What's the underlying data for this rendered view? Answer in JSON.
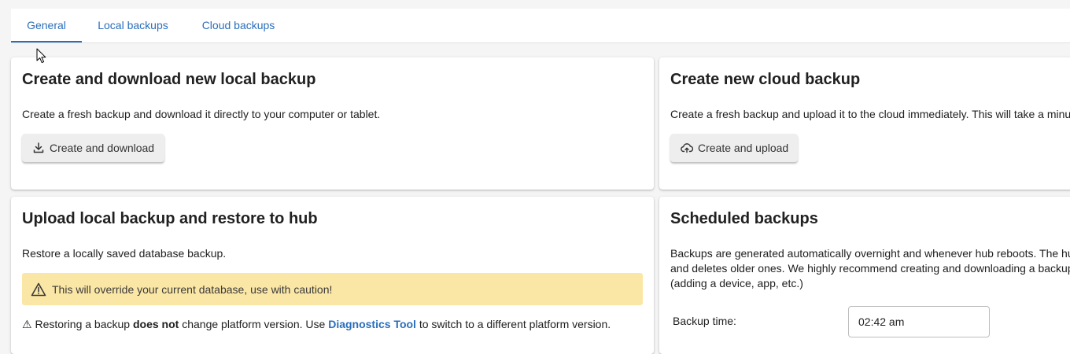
{
  "tabs": [
    {
      "label": "General",
      "active": true
    },
    {
      "label": "Local backups",
      "active": false
    },
    {
      "label": "Cloud backups",
      "active": false
    }
  ],
  "colors": {
    "accent": "#2a6ebb",
    "warning_bg": "#fbe7a5",
    "button_bg": "#eeeeee"
  },
  "local_backup": {
    "title": "Create and download new local backup",
    "description": "Create a fresh backup and download it directly to your computer or tablet.",
    "button_label": "Create and download",
    "button_icon": "download-icon"
  },
  "cloud_backup": {
    "title": "Create new cloud backup",
    "description": "Create a fresh backup and upload it to the cloud immediately. This will take a minu",
    "button_label": "Create and upload",
    "button_icon": "cloud-upload-icon"
  },
  "restore": {
    "title": "Upload local backup and restore to hub",
    "description": "Restore a locally saved database backup.",
    "warning": "This will override your current database, use with caution!",
    "note_prefix": "Restoring a backup ",
    "note_bold": "does not",
    "note_middle": " change platform version. Use ",
    "note_link": "Diagnostics Tool",
    "note_suffix": " to switch to a different platform version."
  },
  "scheduled": {
    "title": "Scheduled backups",
    "lines": [
      "Backups are generated automatically overnight and whenever hub reboots. The hu",
      "and deletes older ones. We highly recommend creating and downloading a backup",
      "(adding a device, app, etc.)"
    ],
    "time_label": "Backup time:",
    "time_value": "02:42 am"
  }
}
